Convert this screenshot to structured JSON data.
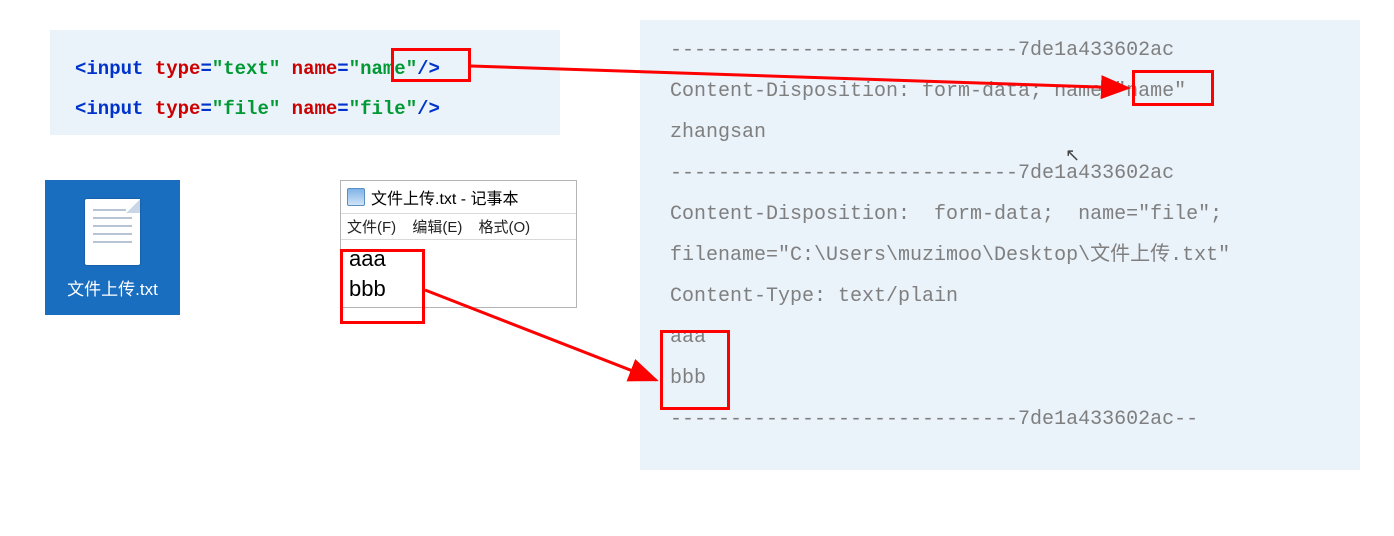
{
  "code": {
    "line1": {
      "tag_open": "<input ",
      "type_attr": "type",
      "eq": "=",
      "type_val": "\"text\"",
      "sp": " ",
      "name_attr": "name",
      "name_val": "\"name\"",
      "close": "/>"
    },
    "line2": {
      "tag_open": "<input ",
      "type_attr": "type",
      "eq": "=",
      "type_val": "\"file\"",
      "sp": " ",
      "name_attr": "name",
      "name_val": "\"file\"",
      "close": "/>"
    }
  },
  "desktop_icon": {
    "filename": "文件上传.txt"
  },
  "notepad": {
    "title": "文件上传.txt - 记事本",
    "menu": {
      "file": "文件(F)",
      "edit": "编辑(E)",
      "format": "格式(O)"
    },
    "content": {
      "l1": "aaa",
      "l2": "bbb"
    }
  },
  "http": {
    "b1": "-----------------------------7de1a433602ac",
    "cd1_a": "Content-Disposition: form-data; name=",
    "cd1_b": "\"name\"",
    "v1": "zhangsan",
    "b2": "-----------------------------7de1a433602ac",
    "cd2": "Content-Disposition:  form-data;  name=\"file\";",
    "fn": "filename=\"C:\\Users\\muzimoo\\Desktop\\文件上传.txt\"",
    "ct": "Content-Type: text/plain",
    "c1": "aaa",
    "c2": "bbb",
    "b3": "-----------------------------7de1a433602ac--"
  }
}
